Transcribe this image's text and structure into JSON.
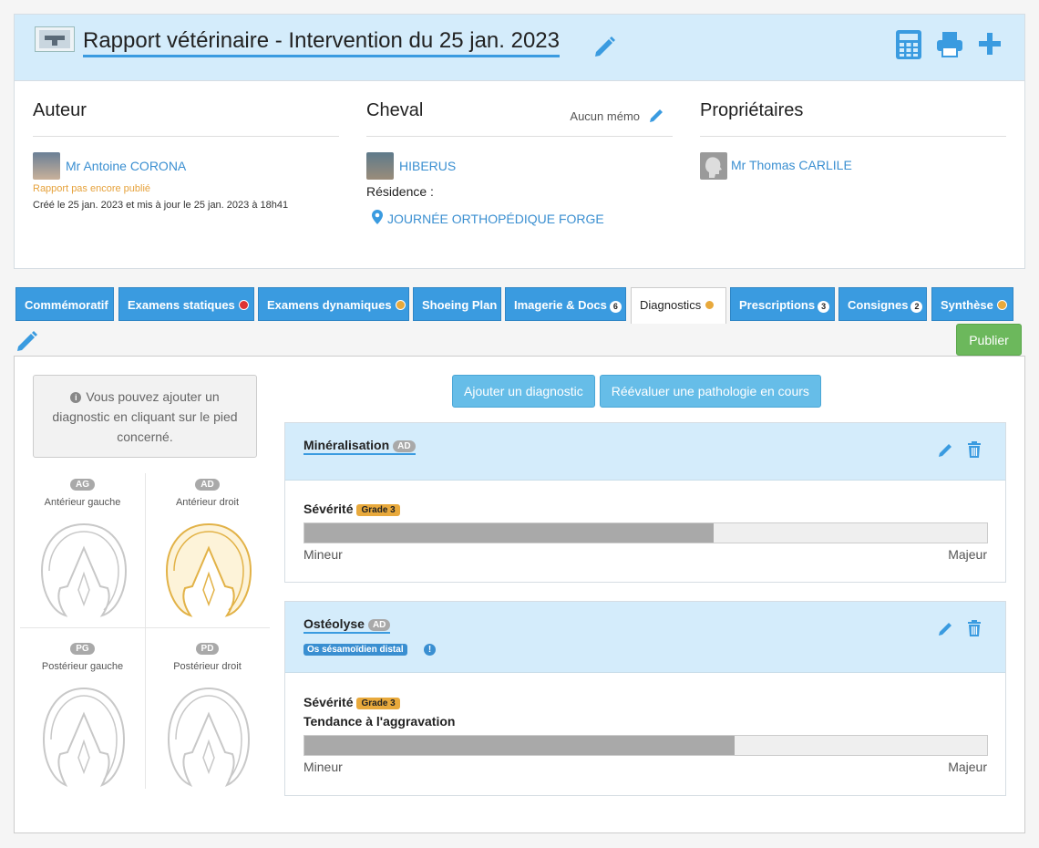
{
  "header": {
    "title": "Rapport vétérinaire - Intervention du 25 jan. 2023",
    "icons": [
      "pencil-icon",
      "calculator-icon",
      "printer-icon",
      "plus-icon"
    ],
    "accent": "#3a9be0"
  },
  "author": {
    "heading": "Auteur",
    "name": "Mr Antoine CORONA",
    "status": "Rapport pas encore publié",
    "created": "Créé le 25 jan. 2023 et mis à jour le 25 jan. 2023 à 18h41"
  },
  "horse": {
    "heading": "Cheval",
    "memo": "Aucun mémo",
    "name": "HIBERUS",
    "residence_label": "Résidence :",
    "residence": "JOURNÉE ORTHOPÉDIQUE FORGE"
  },
  "owners": {
    "heading": "Propriétaires",
    "name": "Mr Thomas CARLILE"
  },
  "tabs": [
    {
      "label": "Commémoratif"
    },
    {
      "label": "Examens statiques",
      "status": "red"
    },
    {
      "label": "Examens dynamiques",
      "status": "orange"
    },
    {
      "label": "Shoeing Plan"
    },
    {
      "label": "Imagerie & Docs",
      "count": "6"
    },
    {
      "label": "Diagnostics",
      "status": "orange",
      "active": true
    },
    {
      "label": "Prescriptions",
      "count": "3"
    },
    {
      "label": "Consignes",
      "count": "2"
    },
    {
      "label": "Synthèse",
      "status": "orange"
    }
  ],
  "publish_label": "Publier",
  "hint": "Vous pouvez ajouter un diagnostic en cliquant sur le pied concerné.",
  "feet": [
    {
      "code": "AG",
      "label": "Antérieur gauche",
      "selected": false
    },
    {
      "code": "AD",
      "label": "Antérieur droit",
      "selected": true
    },
    {
      "code": "PG",
      "label": "Postérieur gauche",
      "selected": false
    },
    {
      "code": "PD",
      "label": "Postérieur droit",
      "selected": false
    }
  ],
  "actions": {
    "add": "Ajouter un diagnostic",
    "reassess": "Réévaluer une pathologie en cours"
  },
  "diagnostics": [
    {
      "title": "Minéralisation",
      "foot": "AD",
      "severity_label": "Sévérité",
      "grade": "Grade 3",
      "severity_level": 0.6,
      "min_label": "Mineur",
      "max_label": "Majeur"
    },
    {
      "title": "Ostéolyse",
      "foot": "AD",
      "location": "Os sésamoïdien distal",
      "severity_label": "Sévérité",
      "grade": "Grade 3",
      "trend": "Tendance à l'aggravation",
      "severity_level": 0.63,
      "min_label": "Mineur",
      "max_label": "Majeur"
    }
  ]
}
